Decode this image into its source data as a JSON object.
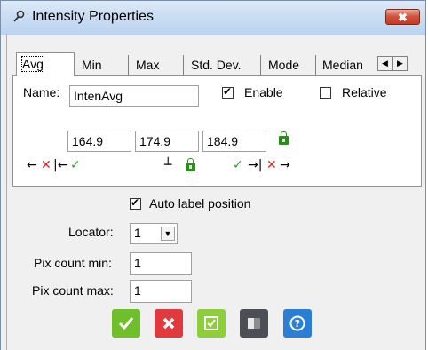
{
  "window": {
    "title": "Intensity Properties",
    "close_label": "✖"
  },
  "tabs": [
    "Avg",
    "Min",
    "Max",
    "Std. Dev.",
    "Mode",
    "Median"
  ],
  "tab_scroll": {
    "left": "◀",
    "right": "▶"
  },
  "panel": {
    "name_label": "Name:",
    "name_value": "IntenAvg",
    "enable_label": "Enable",
    "enable_checked": true,
    "relative_label": "Relative",
    "relative_checked": false,
    "values": [
      "164.9",
      "174.9",
      "184.9"
    ],
    "symbols": {
      "left_low": "←",
      "left_x": "✕",
      "left_bar": "|←",
      "left_check": "✓",
      "mid": "┴",
      "right_check": "✓",
      "right_bar": "→|",
      "right_x": "✕",
      "right_arrow": "→"
    }
  },
  "auto_label": {
    "label": "Auto label position",
    "checked": true
  },
  "locator": {
    "label": "Locator:",
    "value": "1"
  },
  "pix_min": {
    "label": "Pix count min:",
    "value": "1"
  },
  "pix_max": {
    "label": "Pix count max:",
    "value": "1"
  },
  "colors": {
    "ok": "#6fbf2a",
    "cancel": "#e0393e",
    "apply": "#8ccf3b",
    "toggle": "#4b4f55",
    "help": "#2a7fd4"
  },
  "action_icons": [
    "check-icon",
    "close-icon",
    "checkbox-icon",
    "panel-icon",
    "help-icon"
  ]
}
